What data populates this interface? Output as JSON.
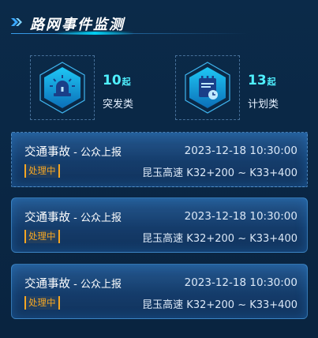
{
  "header": {
    "title": "路网事件监测",
    "icon": "double-chevron-icon"
  },
  "stats": [
    {
      "count": "10",
      "unit": "起",
      "label": "突发类",
      "icon": "siren-icon"
    },
    {
      "count": "13",
      "unit": "起",
      "label": "计划类",
      "icon": "plan-calendar-icon"
    }
  ],
  "events": [
    {
      "category": "交通事故",
      "separator": " - ",
      "source": "公众上报",
      "time": "2023-12-18 10:30:00",
      "status": "处理中",
      "location": "昆玉高速 K32+200 ~ K33+400"
    },
    {
      "category": "交通事故",
      "separator": " - ",
      "source": "公众上报",
      "time": "2023-12-18 10:30:00",
      "status": "处理中",
      "location": "昆玉高速 K32+200 ~ K33+400"
    },
    {
      "category": "交通事故",
      "separator": " - ",
      "source": "公众上报",
      "time": "2023-12-18 10:30:00",
      "status": "处理中",
      "location": "昆玉高速 K32+200 ~ K33+400"
    }
  ],
  "colors": {
    "accent": "#4ff0ff",
    "status": "#f5a623",
    "background": "#0b2a49"
  }
}
